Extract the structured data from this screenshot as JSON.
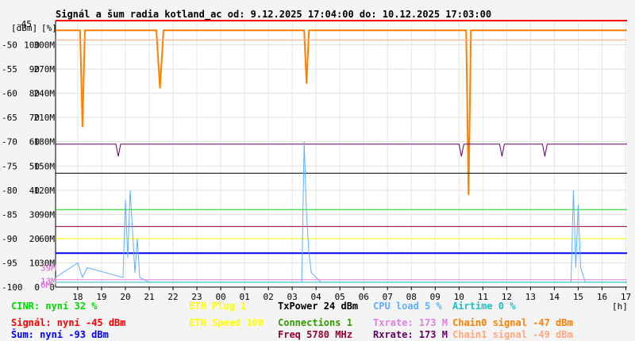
{
  "chart_data": {
    "type": "line",
    "title": "Signál a šum radia kotland_ac od: 9.12.2025 17:04:00 do: 10.12.2025 17:03:00",
    "axis_label_left": "[dBm]",
    "axis_label_mid": "[%]",
    "xlabel": "[h]",
    "xlim": [
      17.07,
      41.05
    ],
    "ylim_dbm": [
      -100,
      -45
    ],
    "y_ticks": [
      {
        "dbm": "-45",
        "pct": "",
        "rate": ""
      },
      {
        "dbm": "-50",
        "pct": "100",
        "rate": "300M"
      },
      {
        "dbm": "-55",
        "pct": "90",
        "rate": "270M"
      },
      {
        "dbm": "-60",
        "pct": "80",
        "rate": "240M"
      },
      {
        "dbm": "-65",
        "pct": "70",
        "rate": "210M"
      },
      {
        "dbm": "-70",
        "pct": "60",
        "rate": "180M"
      },
      {
        "dbm": "-75",
        "pct": "50",
        "rate": "150M"
      },
      {
        "dbm": "-80",
        "pct": "40",
        "rate": "120M"
      },
      {
        "dbm": "-85",
        "pct": "30",
        "rate": "90M"
      },
      {
        "dbm": "-90",
        "pct": "20",
        "rate": "60M"
      },
      {
        "dbm": "-95",
        "pct": "10",
        "rate": "30M"
      },
      {
        "dbm": "-100",
        "pct": "0",
        "rate": "0"
      }
    ],
    "overlay_labels": [
      {
        "text": "39M",
        "dbm": -96
      },
      {
        "text": "13M",
        "dbm": -98.8
      },
      {
        "text": "6M",
        "dbm": -99.5
      }
    ],
    "x_ticks": [
      "18",
      "19",
      "20",
      "21",
      "22",
      "23",
      "00",
      "01",
      "02",
      "03",
      "04",
      "05",
      "06",
      "07",
      "08",
      "09",
      "10",
      "11",
      "12",
      "13",
      "14",
      "15",
      "16",
      "17"
    ],
    "x_tick_hours": [
      18,
      19,
      20,
      21,
      22,
      23,
      24,
      25,
      26,
      27,
      28,
      29,
      30,
      31,
      32,
      33,
      34,
      35,
      36,
      37,
      38,
      39,
      40,
      41
    ],
    "series": [
      {
        "name": "Signál",
        "color": "#ff0000",
        "x": [
          17.07,
          41.05
        ],
        "y": [
          -45,
          -45
        ]
      },
      {
        "name": "Chain0 signal",
        "color": "#ff8000",
        "x": [
          17.07,
          18.1,
          18.2,
          18.3,
          21.3,
          21.45,
          21.6,
          27.5,
          27.6,
          27.7,
          34.3,
          34.4,
          34.5,
          41.05
        ],
        "y": [
          -47,
          -47,
          -67,
          -47,
          -47,
          -59,
          -47,
          -47,
          -58,
          -47,
          -47,
          -81,
          -47,
          -47
        ]
      },
      {
        "name": "Chain1 signal",
        "color": "#ffa880",
        "x": [
          17.07,
          41.05
        ],
        "y": [
          -49,
          -49
        ]
      },
      {
        "name": "Šum",
        "color": "#0000ff",
        "x": [
          17.07,
          41.05
        ],
        "y": [
          -93,
          -93
        ]
      },
      {
        "name": "TxPower",
        "color": "#000000",
        "x": [
          17.07,
          41.05
        ],
        "y": [
          -76.5,
          -76.5
        ]
      },
      {
        "name": "CINR",
        "color": "#00dd00",
        "x": [
          17.07,
          41.05
        ],
        "y": [
          -84,
          -84
        ]
      },
      {
        "name": "ETH Speed",
        "color": "#ffff00",
        "x": [
          17.07,
          41.05
        ],
        "y": [
          -90,
          -90
        ]
      },
      {
        "name": "Freq",
        "color": "#990033",
        "x": [
          17.07,
          41.05
        ],
        "y": [
          -87.5,
          -87.5
        ]
      },
      {
        "name": "Rxrate",
        "color": "#660066",
        "x": [
          17.07,
          19.6,
          19.7,
          19.8,
          34.0,
          34.1,
          34.2,
          35.7,
          35.8,
          35.9,
          37.5,
          37.6,
          37.7,
          41.05
        ],
        "y": [
          -70.5,
          -70.5,
          -73,
          -70.5,
          -70.5,
          -73,
          -70.5,
          -70.5,
          -73,
          -70.5,
          -70.5,
          -73,
          -70.5,
          -70.5
        ]
      },
      {
        "name": "CPU load",
        "color": "#60b0ff",
        "x": [
          17.07,
          18.0,
          18.2,
          18.4,
          19.9,
          20.0,
          20.1,
          20.2,
          20.4,
          20.5,
          20.6,
          21.0,
          27.4,
          27.5,
          27.6,
          27.7,
          27.8,
          28.2,
          38.7,
          38.8,
          38.9,
          39.0,
          39.1,
          39.3,
          41.05
        ],
        "y": [
          -98,
          -95,
          -98,
          -96,
          -98,
          -82,
          -94,
          -80,
          -97,
          -90,
          -98,
          -99,
          -99,
          -70,
          -85,
          -93,
          -97,
          -99,
          -99,
          -80,
          -96,
          -83,
          -96,
          -99,
          -99
        ]
      },
      {
        "name": "Airtime",
        "color": "#20c0c0",
        "x": [
          17.07,
          41.05
        ],
        "y": [
          -99,
          -99
        ]
      },
      {
        "name": "Txrate",
        "color": "#e080e0",
        "x": [
          17.07,
          41.05
        ],
        "y": [
          -98.5,
          -98.5
        ]
      }
    ],
    "legend": [
      {
        "text": "CINR: nyní 32 %",
        "color": "#00dd00",
        "col": 0,
        "row": 0
      },
      {
        "text": "Signál: nyní -45 dBm",
        "color": "#ff0000",
        "col": 0,
        "row": 1
      },
      {
        "text": "Šum: nyní -93 dBm",
        "color": "#0000ff",
        "col": 0,
        "row": 2
      },
      {
        "text": "ETH Plug 1",
        "color": "#ffff00",
        "col": 1,
        "row": 0
      },
      {
        "text": "ETH Speed 100",
        "color": "#ffff00",
        "col": 1,
        "row": 1
      },
      {
        "text": "TxPower 24 dBm",
        "color": "#000000",
        "col": 2,
        "row": 0
      },
      {
        "text": "Connections 1",
        "color": "#339900",
        "col": 2,
        "row": 1
      },
      {
        "text": "Freq 5780 MHz",
        "color": "#990033",
        "col": 2,
        "row": 2
      },
      {
        "text": "CPU load 5 %",
        "color": "#60b0ff",
        "col": 3,
        "row": 0
      },
      {
        "text": "Txrate: 173 M",
        "color": "#e080e0",
        "col": 3,
        "row": 1
      },
      {
        "text": "Rxrate: 173 M",
        "color": "#660066",
        "col": 3,
        "row": 2
      },
      {
        "text": "Airtime 0 %",
        "color": "#20c0c0",
        "col": 4,
        "row": 0
      },
      {
        "text": "Chain0 signal -47 dBm",
        "color": "#ff8000",
        "col": 4,
        "row": 1
      },
      {
        "text": "Chain1 signal -49 dBm",
        "color": "#ffa880",
        "col": 4,
        "row": 2
      }
    ]
  }
}
